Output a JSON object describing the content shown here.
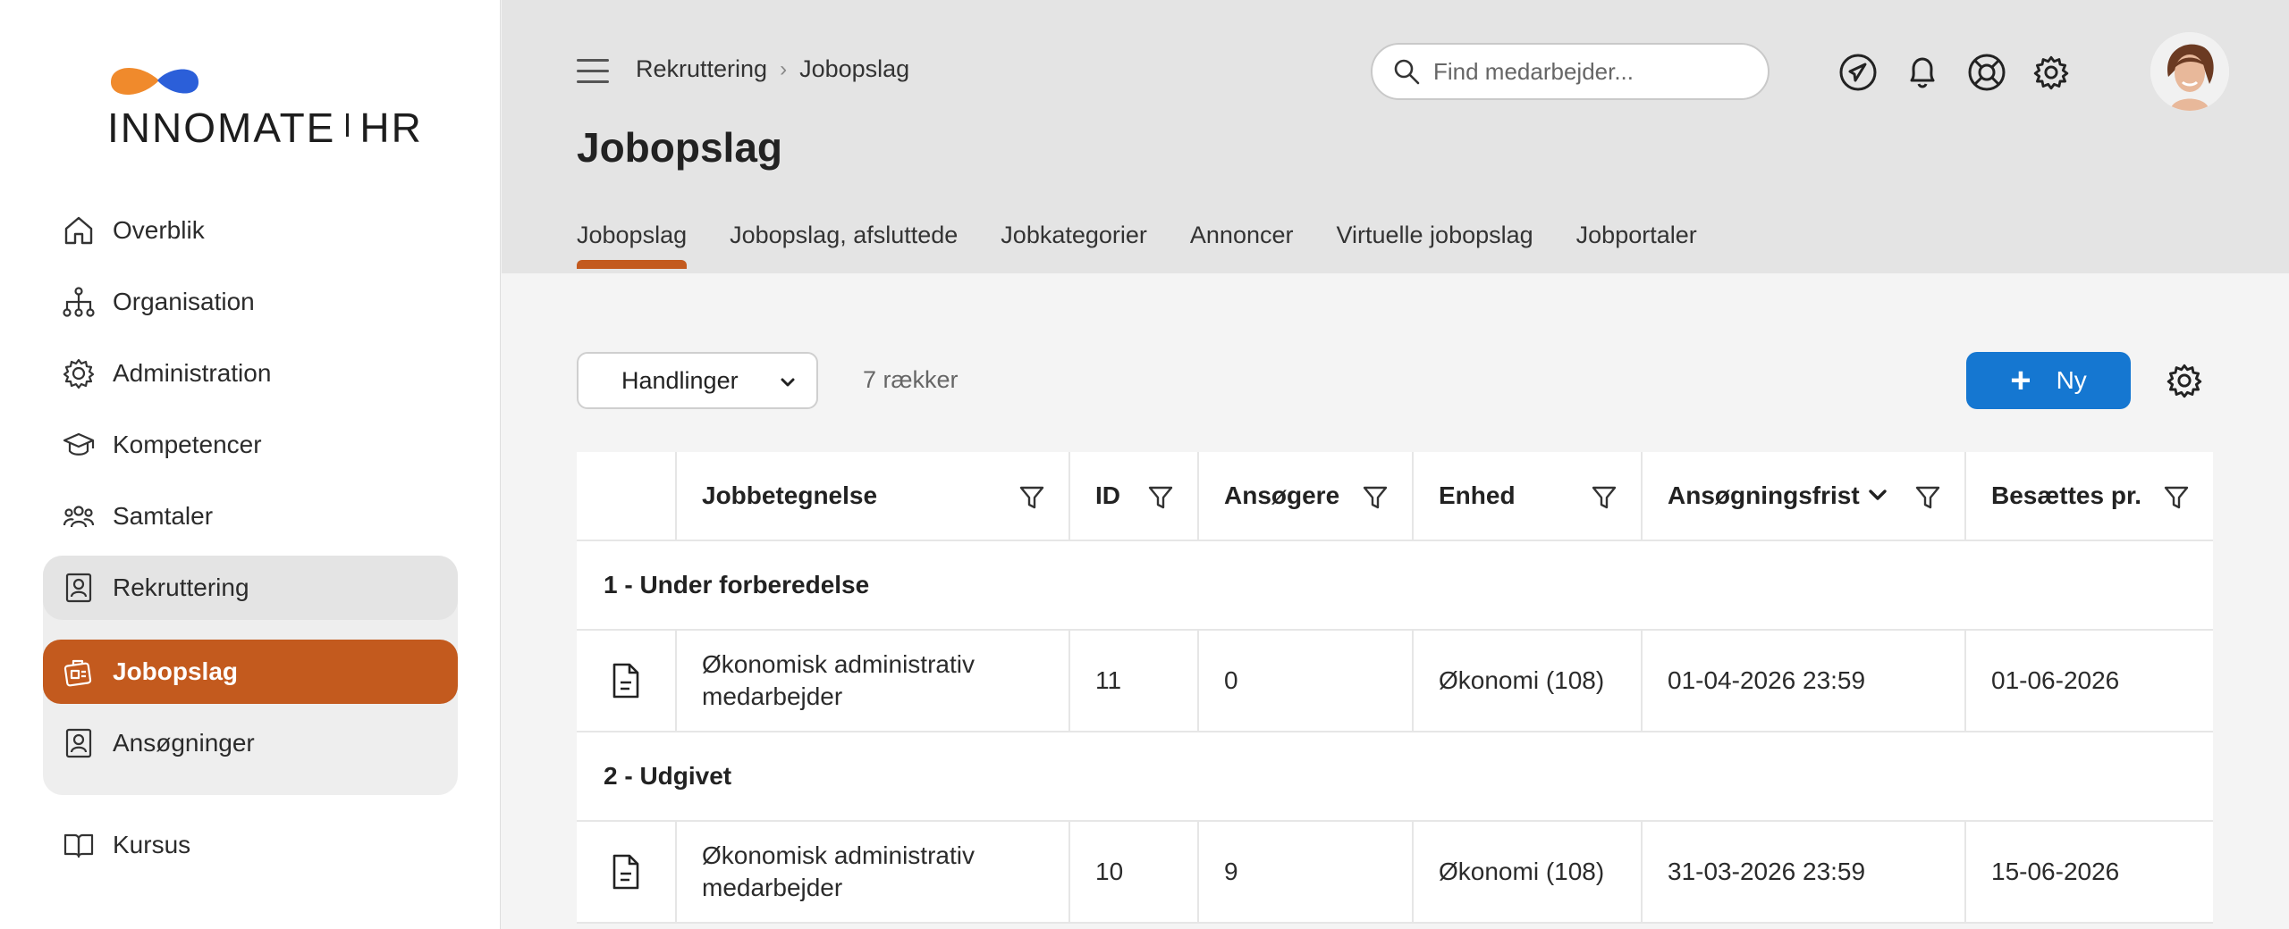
{
  "app": {
    "logo_left": "INNOMATE",
    "logo_right": "HR",
    "brand_orange": "#c35a1e",
    "brand_blue": "#1577d1"
  },
  "sidebar": {
    "items": [
      {
        "label": "Overblik",
        "icon": "home-icon"
      },
      {
        "label": "Organisation",
        "icon": "org-chart-icon"
      },
      {
        "label": "Administration",
        "icon": "gear-icon"
      },
      {
        "label": "Kompetencer",
        "icon": "graduation-cap-icon"
      },
      {
        "label": "Samtaler",
        "icon": "people-icon"
      },
      {
        "label": "Rekruttering",
        "icon": "id-badge-icon"
      },
      {
        "label": "Jobopslag",
        "icon": "job-posting-icon"
      },
      {
        "label": "Ansøgninger",
        "icon": "id-badge-icon"
      },
      {
        "label": "Kursus",
        "icon": "book-icon"
      }
    ]
  },
  "header": {
    "breadcrumb": [
      "Rekruttering",
      "Jobopslag"
    ],
    "search_placeholder": "Find medarbejder...",
    "title": "Jobopslag",
    "tabs": [
      "Jobopslag",
      "Jobopslag, afsluttede",
      "Jobkategorier",
      "Annoncer",
      "Virtuelle jobopslag",
      "Jobportaler"
    ]
  },
  "toolbar": {
    "actions_label": "Handlinger",
    "row_count": "7 rækker",
    "new_label": "Ny"
  },
  "table": {
    "columns": [
      "Jobbetegnelse",
      "ID",
      "Ansøgere",
      "Enhed",
      "Ansøgningsfrist",
      "Besættes pr."
    ],
    "groups": [
      {
        "label": "1 - Under forberedelse",
        "rows": [
          {
            "title_line1": "Økonomisk administrativ",
            "title_line2": "medarbejder",
            "id": "11",
            "applicants": "0",
            "unit": "Økonomi (108)",
            "deadline": "01-04-2026 23:59",
            "fill_by": "01-06-2026"
          }
        ]
      },
      {
        "label": "2 - Udgivet",
        "rows": [
          {
            "title_line1": "Økonomisk administrativ",
            "title_line2": "medarbejder",
            "id": "10",
            "applicants": "9",
            "unit": "Økonomi (108)",
            "deadline": "31-03-2026 23:59",
            "fill_by": "15-06-2026"
          }
        ]
      }
    ]
  }
}
